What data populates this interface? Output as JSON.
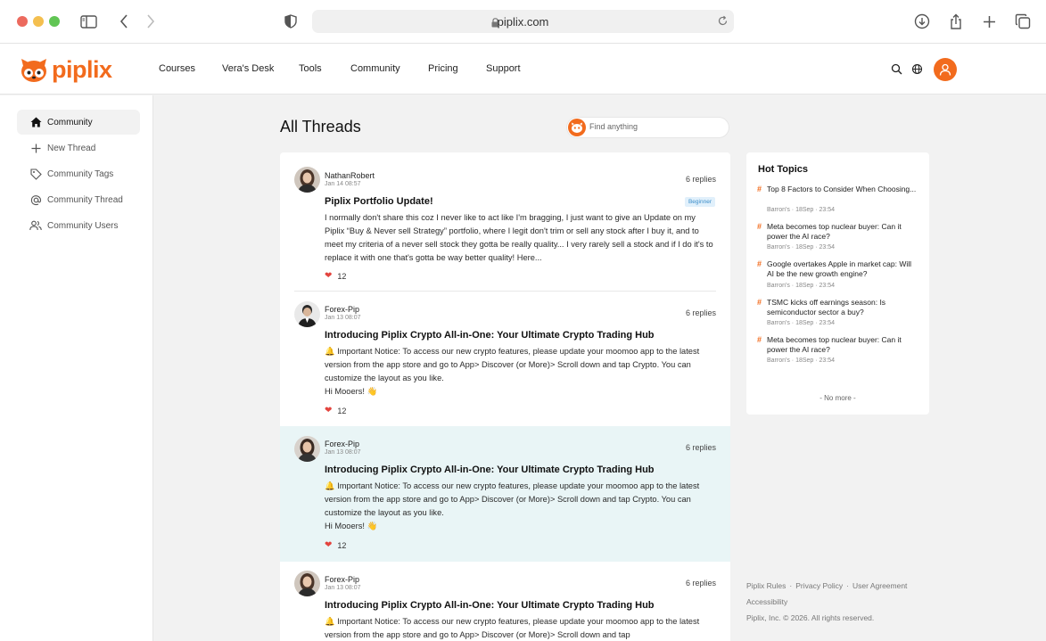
{
  "browser": {
    "url": "piplix.com"
  },
  "brand": {
    "name": "piplix",
    "accent": "#f26b1d"
  },
  "nav": {
    "items": [
      "Courses",
      "Vera's Desk",
      "Tools",
      "Community",
      "Pricing",
      "Support"
    ]
  },
  "sidebar": {
    "items": [
      {
        "label": "Community",
        "icon": "home-icon",
        "active": true
      },
      {
        "label": "New Thread",
        "icon": "plus-icon",
        "active": false
      },
      {
        "label": "Community Tags",
        "icon": "tag-icon",
        "active": false
      },
      {
        "label": "Community Thread",
        "icon": "at-icon",
        "active": false
      },
      {
        "label": "Community Users",
        "icon": "users-icon",
        "active": false
      }
    ]
  },
  "main": {
    "title": "All Threads",
    "search_placeholder": "Find anything"
  },
  "threads": [
    {
      "author": "NathanRobert",
      "date": "Jan 14 08:57",
      "replies": "6 replies",
      "title": "Piplix Portfolio Update!",
      "badge": "Beginner",
      "body": "I normally don't share this coz I never like to act like I'm bragging, I just want to give an Update on my Piplix “Buy & Never sell Strategy” portfolio, where I legit don't trim or sell any stock after I buy it, and to meet my criteria of a never sell stock they gotta be really quality... I very rarely sell a stock and if I do it's to replace it with one that's gotta be way better quality! Here...",
      "likes": "12"
    },
    {
      "author": "Forex-Pip",
      "date": "Jan 13 08:07",
      "replies": "6 replies",
      "title": "Introducing Piplix Crypto All-in-One: Your Ultimate Crypto Trading Hub",
      "body": "🔔 Important Notice: To access our new crypto features, please update your moomoo app to the latest version from the app store and go to App> Discover (or More)> Scroll down and tap Crypto. You can customize the layout as you like.",
      "body2": "Hi Mooers! 👋",
      "likes": "12"
    },
    {
      "author": "Forex-Pip",
      "date": "Jan 13 08:07",
      "replies": "6 replies",
      "title": "Introducing Piplix Crypto All-in-One: Your Ultimate Crypto Trading Hub",
      "body": "🔔 Important Notice: To access our new crypto features, please update your moomoo app to the latest version from the app store and go to App> Discover (or More)> Scroll down and tap Crypto. You can customize the layout as you like.",
      "body2": "Hi Mooers! 👋",
      "likes": "12"
    },
    {
      "author": "Forex-Pip",
      "date": "Jan 13 08:07",
      "replies": "6 replies",
      "title": "Introducing Piplix Crypto All-in-One: Your Ultimate Crypto Trading Hub",
      "body": "🔔 Important Notice: To access our new crypto features, please update your moomoo app to the latest version from the app store and go to App> Discover (or More)> Scroll down and tap"
    }
  ],
  "hot_topics": {
    "title": "Hot Topics",
    "items": [
      {
        "text": "Top 8 Factors to Consider When Choosing...",
        "meta": "Barron's · 18Sep · 23:54"
      },
      {
        "text": "Meta becomes top nuclear buyer: Can it power the AI race?",
        "meta": "Barron's · 18Sep · 23:54"
      },
      {
        "text": "Google overtakes Apple in market cap: Will AI be the new growth engine?",
        "meta": "Barron's · 18Sep · 23:54"
      },
      {
        "text": "TSMC kicks off earnings season: Is semiconductor sector a buy?",
        "meta": "Barron's · 18Sep · 23:54"
      },
      {
        "text": "Meta becomes top nuclear buyer: Can it power the AI race?",
        "meta": "Barron's · 18Sep · 23:54"
      }
    ],
    "no_more": "- No more -"
  },
  "footer": {
    "links": [
      "Piplix Rules",
      "Privacy Policy",
      "User Agreement",
      "Accessibility"
    ],
    "copyright": "Piplix, Inc. © 2026. All rights reserved."
  }
}
